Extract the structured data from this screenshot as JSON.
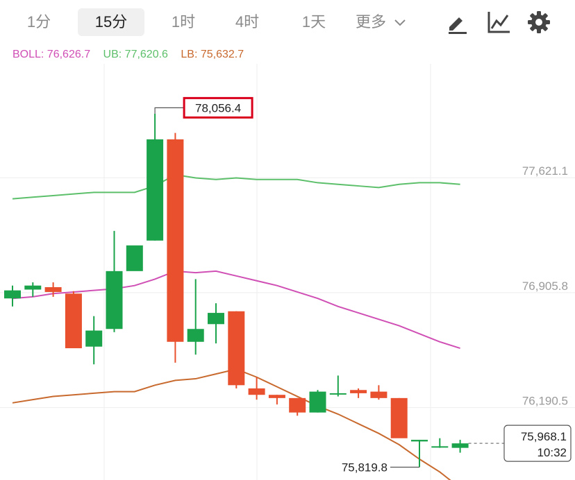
{
  "toolbar": {
    "tabs": [
      {
        "label": "1分",
        "active": false
      },
      {
        "label": "15分",
        "active": true
      },
      {
        "label": "1时",
        "active": false
      },
      {
        "label": "4时",
        "active": false
      },
      {
        "label": "1天",
        "active": false
      }
    ],
    "more_label": "更多",
    "icons": [
      "draw-pen-icon",
      "indicator-chart-icon",
      "settings-gear-icon"
    ]
  },
  "legend": {
    "boll": "BOLL: 76,626.7",
    "ub": "UB: 77,620.6",
    "lb": "LB: 75,632.7"
  },
  "colors": {
    "up": "#1aa34a",
    "down": "#e8502e",
    "boll": "#d04fb5",
    "ub": "#5cbf6a",
    "lb": "#c8692e",
    "highlight_box": "#d9001b"
  },
  "chart_data": {
    "type": "candlestick",
    "ylim": [
      75740,
      78330
    ],
    "y_ticks": [
      {
        "value": 77621.1,
        "label": "77,621.1"
      },
      {
        "value": 76905.8,
        "label": "76,905.8"
      },
      {
        "value": 76190.5,
        "label": "76,190.5"
      }
    ],
    "annotations": {
      "max": {
        "index": 7,
        "value": 78056.4,
        "label": "78,056.4"
      },
      "min": {
        "index": 20,
        "value": 75819.8,
        "label": "75,819.8"
      }
    },
    "last_price": {
      "value": 75968.1,
      "label": "75,968.1",
      "time": "10:32"
    },
    "candles": [
      {
        "o": 76870,
        "h": 76950,
        "l": 76820,
        "c": 76920
      },
      {
        "o": 76925,
        "h": 76970,
        "l": 76880,
        "c": 76950
      },
      {
        "o": 76940,
        "h": 76970,
        "l": 76880,
        "c": 76910
      },
      {
        "o": 76900,
        "h": 76915,
        "l": 76560,
        "c": 76560
      },
      {
        "o": 76570,
        "h": 76760,
        "l": 76460,
        "c": 76670
      },
      {
        "o": 76680,
        "h": 77290,
        "l": 76660,
        "c": 77040
      },
      {
        "o": 77040,
        "h": 77170,
        "l": 77050,
        "c": 77200
      },
      {
        "o": 77230,
        "h": 78020,
        "l": 77230,
        "c": 77860
      },
      {
        "o": 77860,
        "h": 77900,
        "l": 76470,
        "c": 76600
      },
      {
        "o": 76600,
        "h": 76990,
        "l": 76520,
        "c": 76680
      },
      {
        "o": 76710,
        "h": 76840,
        "l": 76590,
        "c": 76780
      },
      {
        "o": 76790,
        "h": 76790,
        "l": 76310,
        "c": 76330
      },
      {
        "o": 76310,
        "h": 76380,
        "l": 76240,
        "c": 76270
      },
      {
        "o": 76270,
        "h": 76270,
        "l": 76210,
        "c": 76250
      },
      {
        "o": 76250,
        "h": 76250,
        "l": 76140,
        "c": 76160
      },
      {
        "o": 76160,
        "h": 76300,
        "l": 76160,
        "c": 76290
      },
      {
        "o": 76280,
        "h": 76390,
        "l": 76260,
        "c": 76280
      },
      {
        "o": 76300,
        "h": 76310,
        "l": 76250,
        "c": 76280
      },
      {
        "o": 76290,
        "h": 76330,
        "l": 76240,
        "c": 76250
      },
      {
        "o": 76250,
        "h": 76250,
        "l": 76010,
        "c": 76000
      },
      {
        "o": 75980,
        "h": 75990,
        "l": 75820,
        "c": 75990
      },
      {
        "o": 75950,
        "h": 76000,
        "l": 75940,
        "c": 75950
      },
      {
        "o": 75940,
        "h": 75990,
        "l": 75910,
        "c": 75968
      }
    ],
    "ub_line": [
      77490,
      77500,
      77510,
      77520,
      77530,
      77530,
      77530,
      77570,
      77640,
      77620,
      77610,
      77620,
      77610,
      77610,
      77610,
      77590,
      77580,
      77570,
      77560,
      77580,
      77590,
      77590,
      77580
    ],
    "boll_line": [
      76870,
      76880,
      76900,
      76910,
      76920,
      76930,
      76950,
      76990,
      77040,
      77030,
      77040,
      77010,
      76980,
      76950,
      76910,
      76870,
      76820,
      76780,
      76740,
      76700,
      76650,
      76600,
      76560
    ],
    "lb_line": [
      76220,
      76240,
      76260,
      76270,
      76280,
      76290,
      76290,
      76330,
      76360,
      76370,
      76400,
      76430,
      76380,
      76320,
      76260,
      76200,
      76150,
      76090,
      76030,
      75960,
      75870,
      75790,
      75690
    ]
  }
}
